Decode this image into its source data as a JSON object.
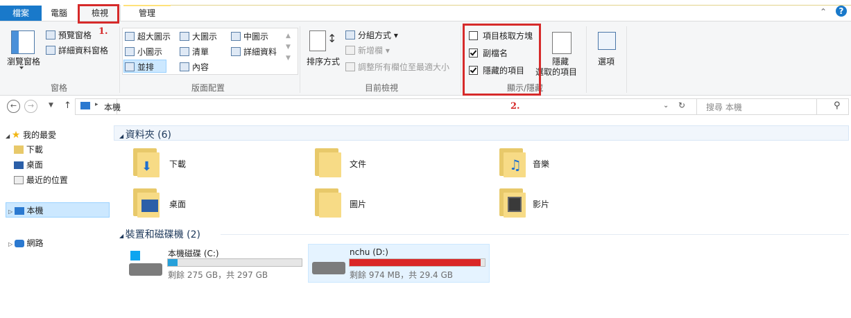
{
  "tabs": {
    "file": "檔案",
    "computer": "電腦",
    "view": "檢視",
    "manage": "管理"
  },
  "ribbon": {
    "panes": {
      "nav_pane": "瀏覽窗格",
      "preview_pane": "預覽窗格",
      "details_pane": "詳細資料窗格",
      "label": "窗格"
    },
    "layout": {
      "items": [
        "超大圖示",
        "大圖示",
        "中圖示",
        "小圖示",
        "清單",
        "詳細資料",
        "並排",
        "內容"
      ],
      "label": "版面配置"
    },
    "current_view": {
      "sort": "排序方式",
      "group_by": "分組方式",
      "add_columns": "新增欄",
      "size_columns": "調整所有欄位至最適大小",
      "label": "目前檢視"
    },
    "show_hide": {
      "item_checkboxes": "項目核取方塊",
      "item_checkboxes_checked": false,
      "file_extensions": "副檔名",
      "file_extensions_checked": true,
      "hidden_items": "隱藏的項目",
      "hidden_items_checked": true,
      "hide_selected_1": "隱藏",
      "hide_selected_2": "選取的項目",
      "label": "顯示/隱藏"
    },
    "options": "選項"
  },
  "annotations": {
    "note1": "1.",
    "note2": "2."
  },
  "address": {
    "location": "本機",
    "search_placeholder": "搜尋 本機"
  },
  "nav": {
    "favorites": "我的最愛",
    "downloads": "下載",
    "desktop": "桌面",
    "recent": "最近的位置",
    "this_pc": "本機",
    "network": "網路"
  },
  "folders": {
    "header": "資料夾 (6)",
    "items": [
      "下載",
      "文件",
      "音樂",
      "桌面",
      "圖片",
      "影片"
    ]
  },
  "drives": {
    "header": "裝置和磁碟機 (2)",
    "items": [
      {
        "name": "本機磁碟 (C:)",
        "free": "剩餘 275 GB，共 297 GB",
        "used_fraction": 0.074,
        "color": "#26a0da"
      },
      {
        "name": "nchu (D:)",
        "free": "剩餘 974 MB，共 29.4 GB",
        "used_fraction": 0.968,
        "color": "#da2626"
      }
    ]
  },
  "colors": {
    "accent": "#1979ca",
    "annotation_red": "#d62a2a",
    "selection": "#cce8ff"
  }
}
